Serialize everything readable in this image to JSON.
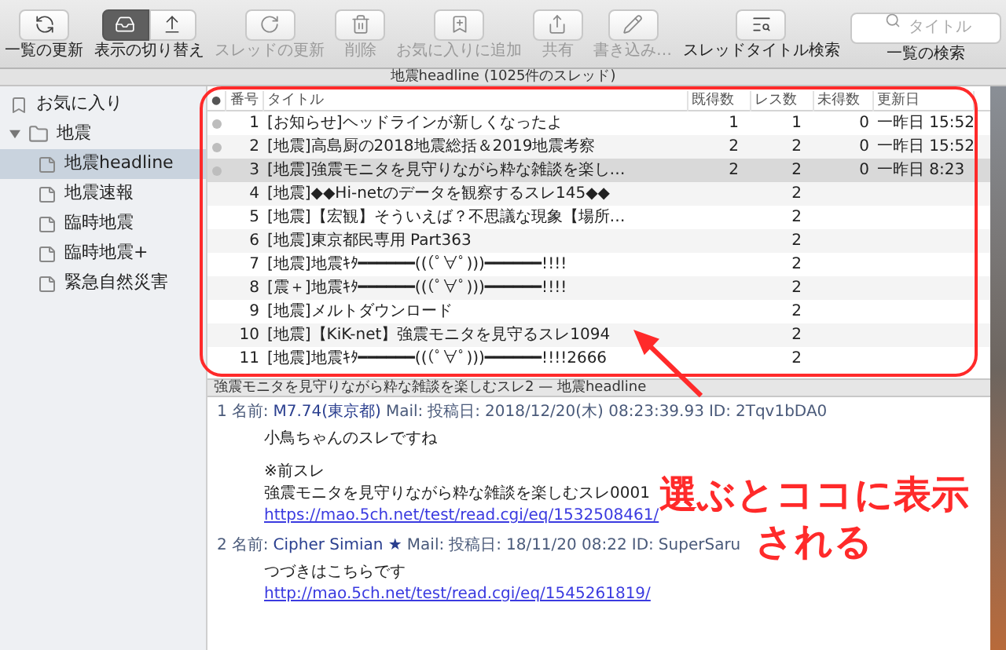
{
  "toolbar": [
    {
      "kind": "button",
      "label": "一覧の更新",
      "disabled": false
    },
    {
      "kind": "segmented",
      "label": "表示の切り替え",
      "segments": [
        {
          "selected": true
        },
        {
          "selected": false
        }
      ]
    },
    {
      "kind": "button",
      "label": "スレッドの更新",
      "disabled": true
    },
    {
      "kind": "button",
      "label": "削除",
      "disabled": true
    },
    {
      "kind": "button",
      "label": "お気に入りに追加",
      "disabled": true
    },
    {
      "kind": "button",
      "label": "共有",
      "disabled": true
    },
    {
      "kind": "button",
      "label": "書き込み…",
      "disabled": true
    },
    {
      "kind": "button",
      "label": "スレッドタイトル検索",
      "disabled": false
    },
    {
      "kind": "search",
      "placeholder": "タイトル",
      "label": "一覧の検索"
    }
  ],
  "board_header": "地震headline (1025件のスレッド)",
  "sidebar": {
    "items": [
      {
        "kind": "favorite",
        "label": "お気に入り",
        "selected": false
      },
      {
        "kind": "folder",
        "label": "地震",
        "expanded": true,
        "selected": false,
        "children": [
          {
            "kind": "board",
            "label": "地震headline",
            "selected": true
          },
          {
            "kind": "board",
            "label": "地震速報",
            "selected": false
          },
          {
            "kind": "board",
            "label": "臨時地震",
            "selected": false
          },
          {
            "kind": "board",
            "label": "臨時地震+",
            "selected": false
          },
          {
            "kind": "board",
            "label": "緊急自然災害",
            "selected": false
          }
        ]
      }
    ]
  },
  "table": {
    "columns": [
      "●",
      "番号",
      "タイトル",
      "既得数",
      "レス数",
      "未得数",
      "更新日"
    ],
    "rows": [
      {
        "read": true,
        "selected": false,
        "number": "1",
        "title": "[お知らせ]ヘッドラインが新しくなったよ",
        "got": "1",
        "res": "1",
        "unread": "0",
        "updated": "一昨日 15:52"
      },
      {
        "read": true,
        "selected": false,
        "number": "2",
        "title": "[地震]高島厨の2018地震総括＆2019地震考察",
        "got": "2",
        "res": "2",
        "unread": "0",
        "updated": "一昨日 15:52"
      },
      {
        "read": true,
        "selected": true,
        "number": "3",
        "title": "[地震]強震モニタを見守りながら粋な雑談を楽し…",
        "got": "2",
        "res": "2",
        "unread": "0",
        "updated": "一昨日 8:23"
      },
      {
        "read": false,
        "selected": false,
        "number": "4",
        "title": "[地震]◆◆Hi-netのデータを観察するスレ145◆◆",
        "res": "2"
      },
      {
        "read": false,
        "selected": false,
        "number": "5",
        "title": "[地震]【宏観】そういえば？不思議な現象【場所…",
        "res": "2"
      },
      {
        "read": false,
        "selected": false,
        "number": "6",
        "title": "[地震]東京都民専用 Part363",
        "res": "2"
      },
      {
        "read": false,
        "selected": false,
        "number": "7",
        "title": "[地震]地震ｷﾀ━━━━━━(((ﾟ∀ﾟ)))━━━━━━!!!!",
        "res": "2"
      },
      {
        "read": false,
        "selected": false,
        "number": "8",
        "title": "[震＋]地震ｷﾀ━━━━━━(((ﾟ∀ﾟ)))━━━━━━!!!!",
        "res": "2"
      },
      {
        "read": false,
        "selected": false,
        "number": "9",
        "title": "[地震]メルトダウンロード",
        "res": "2"
      },
      {
        "read": false,
        "selected": false,
        "number": "10",
        "title": "[地震]【KiK-net】強震モニタを見守るスレ1094",
        "res": "2"
      },
      {
        "read": false,
        "selected": false,
        "number": "11",
        "title": "[地震]地震ｷﾀ━━━━━━(((ﾟ∀ﾟ)))━━━━━━!!!!2666",
        "res": "2"
      }
    ]
  },
  "thread_bar": "強震モニタを見守りながら粋な雑談を楽しむスレ2 — 地震headline",
  "posts": [
    {
      "number": "1",
      "name_label": "名前:",
      "name": "M7.74(東京都)",
      "mail_label": "Mail:",
      "date_label": "投稿日:",
      "date": "2018/12/20(木) 08:23:39.93",
      "id_label": "ID:",
      "id": "2Tqv1bDA0",
      "paragraphs": [
        [
          {
            "kind": "text",
            "text": "小鳥ちゃんのスレですね"
          }
        ],
        [
          {
            "kind": "text",
            "text": "※前スレ"
          },
          {
            "kind": "text",
            "text": "強震モニタを見守りながら粋な雑談を楽しむスレ0001"
          },
          {
            "kind": "link",
            "text": "https://mao.5ch.net/test/read.cgi/eq/1532508461/"
          }
        ]
      ]
    },
    {
      "number": "2",
      "name_label": "名前:",
      "name": "Cipher Simian ★",
      "mail_label": "Mail:",
      "date_label": "投稿日:",
      "date": "18/11/20 08:22",
      "id_label": "ID:",
      "id": "SuperSaru",
      "paragraphs": [
        [
          {
            "kind": "text",
            "text": "つづきはこちらです"
          },
          {
            "kind": "link",
            "text": "http://mao.5ch.net/test/read.cgi/eq/1545261819/"
          }
        ]
      ]
    }
  ],
  "annotation": {
    "lines": [
      "選ぶとココに表示",
      "される"
    ]
  }
}
